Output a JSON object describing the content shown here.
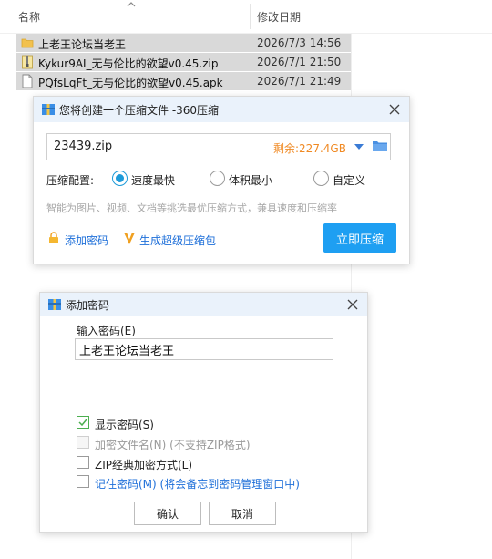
{
  "explorer": {
    "columns": {
      "name": "名称",
      "modified": "修改日期"
    },
    "files": [
      {
        "name": "上老王论坛当老王",
        "date": "2026/7/3 14:56",
        "icon": "folder-icon"
      },
      {
        "name": "Kykur9AI_无与伦比的欲望v0.45.zip",
        "date": "2026/7/1 21:50",
        "icon": "zip-file-icon"
      },
      {
        "name": "PQfsLqFt_无与伦比的欲望v0.45.apk",
        "date": "2026/7/1 21:49",
        "icon": "document-icon"
      }
    ]
  },
  "compress_dialog": {
    "title": "您将创建一个压缩文件 -360压缩",
    "filename": "23439.zip",
    "space_left": "剩余:227.4GB",
    "config_label": "压缩配置:",
    "options": [
      {
        "label": "速度最快",
        "selected": true
      },
      {
        "label": "体积最小",
        "selected": false
      },
      {
        "label": "自定义",
        "selected": false
      }
    ],
    "hint": "智能为图片、视频、文档等挑选最优压缩方式，兼具速度和压缩率",
    "add_password": "添加密码",
    "super_pack": "生成超级压缩包",
    "compress_button": "立即压缩"
  },
  "password_dialog": {
    "title": "添加密码",
    "input_label": "输入密码(E)",
    "password_value": "上老王论坛当老王",
    "show_password": {
      "label": "显示密码(S)",
      "checked": true
    },
    "encrypt_filenames": {
      "label": "加密文件名(N) (不支持ZIP格式)",
      "checked": false,
      "disabled": true
    },
    "zip_classic": {
      "label": "ZIP经典加密方式(L)",
      "checked": false
    },
    "remember": {
      "label": "记住密码(M) (将会备忘到密码管理窗口中)",
      "checked": false
    },
    "ok": "确认",
    "cancel": "取消"
  },
  "colors": {
    "accent": "#1e9ff2",
    "orange": "#f08a24",
    "link": "#1e6fd9",
    "selection": "#d9d9d9"
  }
}
